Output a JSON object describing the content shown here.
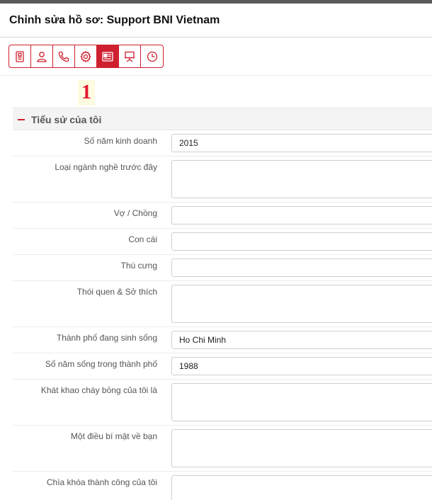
{
  "header": {
    "title": "Chỉnh sửa hồ sơ: Support BNI Vietnam"
  },
  "toolbar": {
    "buttons": [
      {
        "icon": "document-icon",
        "active": false
      },
      {
        "icon": "user-icon",
        "active": false
      },
      {
        "icon": "phone-icon",
        "active": false
      },
      {
        "icon": "gear-icon",
        "active": false
      },
      {
        "icon": "id-card-icon",
        "active": true
      },
      {
        "icon": "presentation-icon",
        "active": false
      },
      {
        "icon": "clock-chart-icon",
        "active": false
      }
    ]
  },
  "annotation": {
    "label": "1"
  },
  "section": {
    "title": "Tiểu sử của tôi"
  },
  "fields": [
    {
      "label": "Số năm kinh doanh",
      "value": "2015",
      "type": "input"
    },
    {
      "label": "Loại ngành nghề trước đây",
      "value": "",
      "type": "textarea"
    },
    {
      "label": "Vợ / Chồng",
      "value": "",
      "type": "input"
    },
    {
      "label": "Con cái",
      "value": "",
      "type": "input"
    },
    {
      "label": "Thú cưng",
      "value": "",
      "type": "input"
    },
    {
      "label": "Thói quen & Sở thích",
      "value": "",
      "type": "textarea"
    },
    {
      "label": "Thành phố đang sinh sống",
      "value": "Ho Chi Minh",
      "type": "input"
    },
    {
      "label": "Số năm sống trong thành phố",
      "value": "1988",
      "type": "input"
    },
    {
      "label": "Khát khao cháy bỏng của tôi là",
      "value": "",
      "type": "textarea"
    },
    {
      "label": "Một điều bí mật về bạn",
      "value": "",
      "type": "textarea"
    },
    {
      "label": "Chìa khóa thành công của tôi",
      "value": "",
      "type": "textarea"
    }
  ],
  "colors": {
    "accent": "#cf2030",
    "topbar": "#5a5a5a",
    "annotation": "#e0182d"
  }
}
